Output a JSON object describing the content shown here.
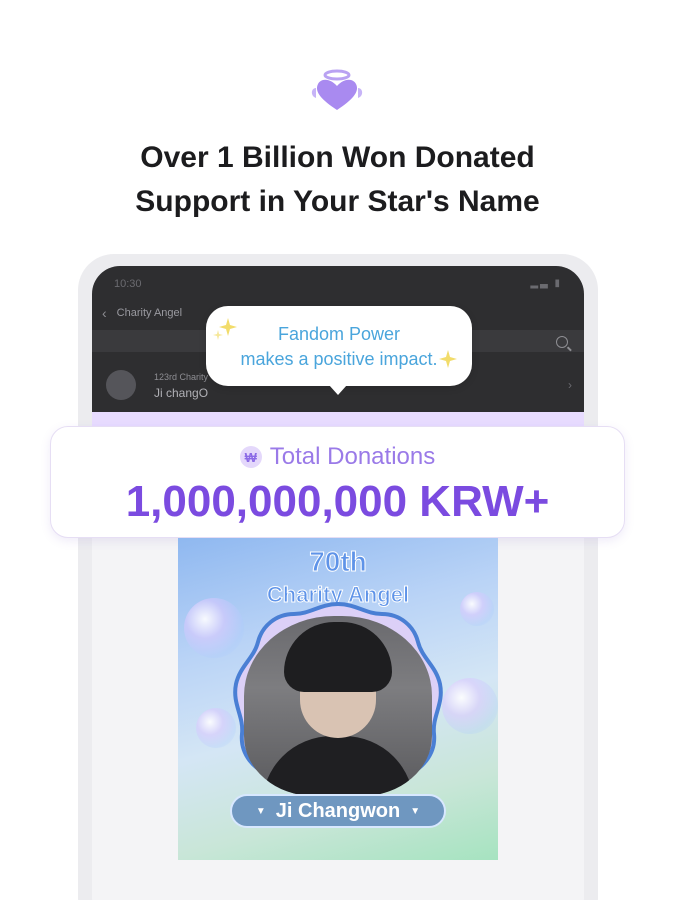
{
  "headline": {
    "line1": "Over 1 Billion Won Donated",
    "line2": "Support in Your Star's Name"
  },
  "app_screen": {
    "status_time": "10:30",
    "nav_title": "Charity Angel",
    "list_item": {
      "subtitle": "123rd Charity",
      "name": "Ji changO"
    }
  },
  "bubble": {
    "line1": "Fandom Power",
    "line2": "makes a positive impact."
  },
  "total": {
    "currency_symbol": "₩",
    "label": "Total Donations",
    "value": "1,000,000,000 KRW+"
  },
  "award": {
    "rank": "70th",
    "title": "Charity Angel",
    "name": "Ji Changwon"
  },
  "icons": {
    "logo": "heart-halo-icon",
    "back": "chevron-left-icon",
    "search": "search-icon",
    "sparkle": "sparkle-icon"
  },
  "colors": {
    "accent_purple": "#7b4be0",
    "label_purple": "#9a7ae8",
    "bubble_blue": "#4aa5dc",
    "award_blue": "#5e93e8"
  }
}
